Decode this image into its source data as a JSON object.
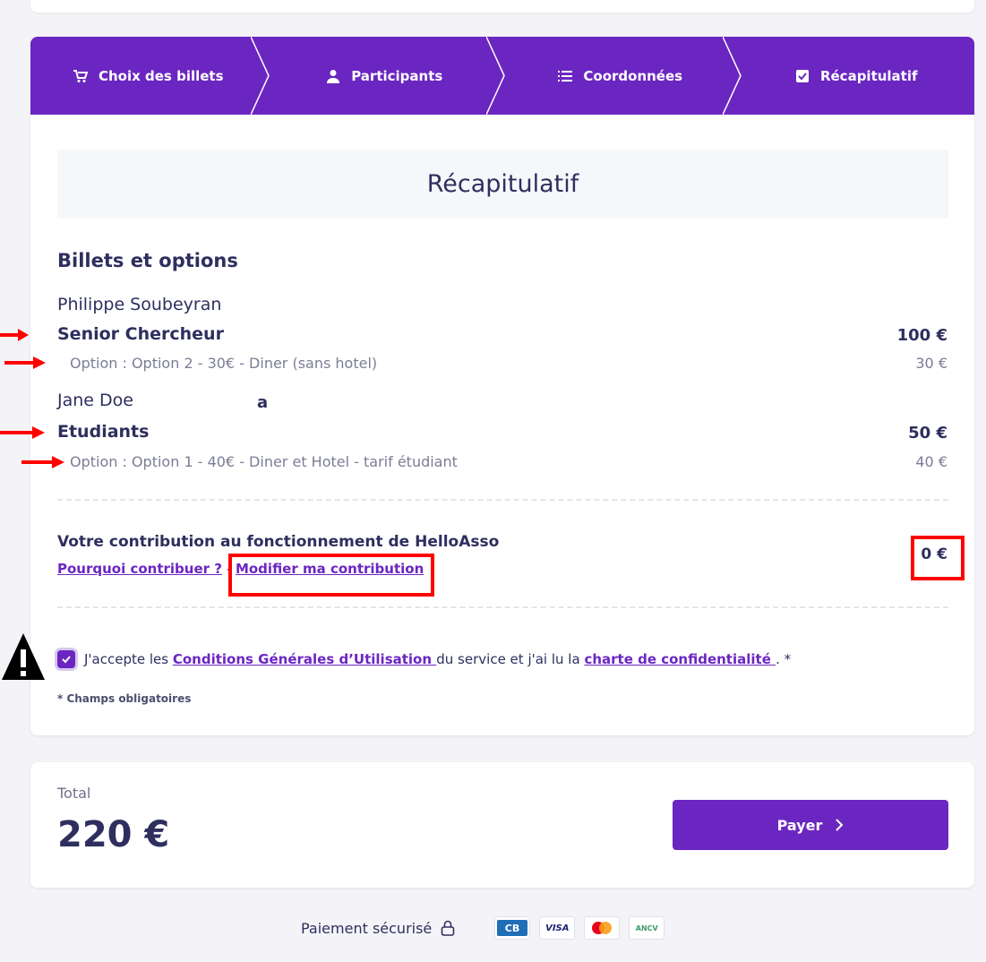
{
  "steps": [
    {
      "label": "Choix des billets",
      "icon": "cart-icon"
    },
    {
      "label": "Participants",
      "icon": "user-icon"
    },
    {
      "label": "Coordonnées",
      "icon": "list-icon"
    },
    {
      "label": "Récapitulatif",
      "icon": "checkbox-icon"
    }
  ],
  "summary": {
    "title": "Récapitulatif",
    "section_title": "Billets et options",
    "participants": [
      {
        "name": "Philippe Soubeyran",
        "ticket": "Senior Chercheur",
        "ticket_price": "100 €",
        "option": "Option : Option 2 - 30€ - Diner (sans hotel)",
        "option_price": "30 €"
      },
      {
        "name": "Jane Doe",
        "ticket": "Etudiants",
        "ticket_price": "50 €",
        "option": "Option : Option 1 - 40€ - Diner et Hotel - tarif étudiant",
        "option_price": "40 €"
      }
    ],
    "stray_text": "a"
  },
  "contribution": {
    "title": "Votre contribution au fonctionnement de HelloAsso",
    "why_link": "Pourquoi contribuer ?",
    "separator": "-",
    "modify_link": "Modifier ma contribution",
    "amount": "0 €"
  },
  "cgu": {
    "prefix": "J'accepte les ",
    "cgu_link": "Conditions Générales d’Utilisation ",
    "middle": " du service et j'ai lu la ",
    "privacy_link": "charte de confidentialité ",
    "suffix": ". *",
    "checked": true
  },
  "required_note": "* Champs obligatoires",
  "total": {
    "label": "Total",
    "amount": "220 €",
    "pay_button": "Payer"
  },
  "secure": {
    "label": "Paiement sécurisé",
    "badges": [
      "CB",
      "VISA",
      "Mastercard",
      "ANCV"
    ]
  },
  "colors": {
    "brand": "#6b26c1",
    "text": "#2e2f5e",
    "muted": "#7b7d95",
    "annotation": "#ff0000"
  }
}
